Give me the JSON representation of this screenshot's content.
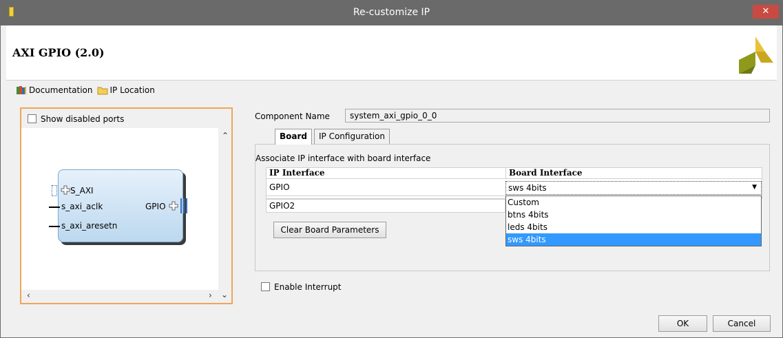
{
  "window": {
    "title": "Re-customize IP",
    "close_label": "✕"
  },
  "header": {
    "title": "AXI GPIO (2.0)"
  },
  "toolbar": {
    "documentation": "Documentation",
    "ip_location": "IP Location"
  },
  "symbol_panel": {
    "show_disabled_label": "Show disabled ports",
    "ports_left": [
      "S_AXI",
      "s_axi_aclk",
      "s_axi_aresetn"
    ],
    "port_right": "GPIO"
  },
  "component": {
    "label": "Component Name",
    "value": "system_axi_gpio_0_0"
  },
  "tabs": [
    {
      "label": "Board"
    },
    {
      "label": "IP Configuration"
    }
  ],
  "board_tab": {
    "description": "Associate IP interface with board interface",
    "headers": [
      "IP Interface",
      "Board Interface"
    ],
    "rows": [
      {
        "ip": "GPIO",
        "board": "sws 4bits"
      },
      {
        "ip": "GPIO2",
        "board": ""
      }
    ],
    "dropdown_options": [
      "Custom",
      "btns 4bits",
      "leds 4bits",
      "sws 4bits"
    ],
    "selected_option": "sws 4bits",
    "clear_button": "Clear Board Parameters"
  },
  "enable_interrupt_label": "Enable Interrupt",
  "footer": {
    "ok": "OK",
    "cancel": "Cancel"
  },
  "colors": {
    "accent_orange": "#f0a55a",
    "selection": "#3399ff",
    "close_red": "#c94a43"
  }
}
